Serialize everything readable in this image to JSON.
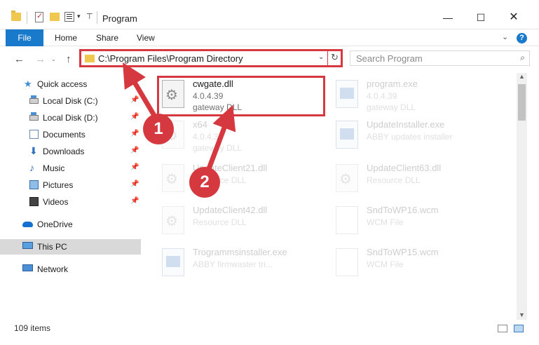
{
  "window": {
    "title": "Program",
    "minimize_glyph": "—",
    "maximize_glyph": "☐",
    "close_glyph": "✕"
  },
  "ribbon": {
    "tabs": [
      "File",
      "Home",
      "Share",
      "View"
    ],
    "collapse_glyph": "⌄",
    "help_glyph": "?"
  },
  "address_bar": {
    "path": "C:\\Program Files\\Program Directory",
    "dropdown_glyph": "⌄",
    "refresh_glyph": "↻"
  },
  "nav_buttons": {
    "back": "←",
    "forward": "→",
    "history": "⌄",
    "up": "↑"
  },
  "search": {
    "placeholder": "Search Program",
    "icon": "search-icon"
  },
  "sidebar": {
    "pin_glyph": "📌",
    "items": [
      {
        "label": "Quick access",
        "icon": "star-icon"
      },
      {
        "label": "Local Disk (C:)",
        "icon": "disk-icon",
        "pinned": true
      },
      {
        "label": "Local Disk (D:)",
        "icon": "disk-icon",
        "pinned": true
      },
      {
        "label": "Documents",
        "icon": "documents-icon",
        "pinned": true
      },
      {
        "label": "Downloads",
        "icon": "downloads-icon",
        "pinned": true
      },
      {
        "label": "Music",
        "icon": "music-icon",
        "pinned": true
      },
      {
        "label": "Pictures",
        "icon": "pictures-icon",
        "pinned": true
      },
      {
        "label": "Videos",
        "icon": "videos-icon",
        "pinned": true
      },
      {
        "label": "OneDrive",
        "icon": "cloud-icon"
      },
      {
        "label": "This PC",
        "icon": "computer-icon",
        "selected": true
      },
      {
        "label": "Network",
        "icon": "network-icon"
      }
    ]
  },
  "files": [
    {
      "name": "cwgate.dll",
      "version": "4.0.4.39",
      "description": "gateway DLL",
      "type": "dll",
      "highlighted": true
    },
    {
      "name": "program.exe",
      "version": "4.0.4.39",
      "description": "gateway DLL",
      "type": "exe"
    },
    {
      "name": "x64",
      "version": "4.0.4.39",
      "description": "gateway DLL",
      "type": "dll"
    },
    {
      "name": "UpdateInstaller.exe",
      "version": "",
      "description": "ABBY updates installer",
      "type": "exe"
    },
    {
      "name": "UpdateClient21.dll",
      "version": "",
      "description": "Resource DLL",
      "type": "dll"
    },
    {
      "name": "UpdateClient63.dll",
      "version": "",
      "description": "Resource DLL",
      "type": "dll"
    },
    {
      "name": "UpdateClient42.dll",
      "version": "",
      "description": "Resource DLL",
      "type": "dll"
    },
    {
      "name": "SndToWP16.wcm",
      "version": "",
      "description": "WCM File",
      "type": "wcm"
    },
    {
      "name": "Trogrammsinstaller.exe",
      "version": "",
      "description": "ABBY firmwaster tri...",
      "type": "exe"
    },
    {
      "name": "SndToWP15.wcm",
      "version": "",
      "description": "WCM File",
      "type": "wcm"
    }
  ],
  "status_bar": {
    "item_count": "109 items"
  },
  "annotations": {
    "step1": "1",
    "step2": "2",
    "color": "#d6383f"
  },
  "colors": {
    "accent": "#1979ca",
    "highlight": "#d6383f",
    "selected_row": "#d9d9d9"
  }
}
